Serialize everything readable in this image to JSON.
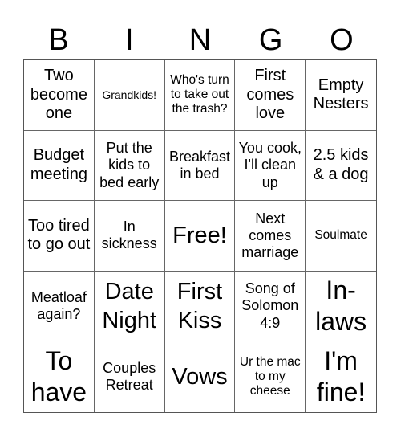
{
  "header": {
    "letters": [
      "B",
      "I",
      "N",
      "G",
      "O"
    ]
  },
  "cells": [
    {
      "text": "Two become one",
      "size": "s-lg"
    },
    {
      "text": "Grandkids!",
      "size": "s-xs"
    },
    {
      "text": "Who's turn to take out the trash?",
      "size": "s-sm"
    },
    {
      "text": "First comes love",
      "size": "s-lg"
    },
    {
      "text": "Empty Nesters",
      "size": "s-lg"
    },
    {
      "text": "Budget meeting",
      "size": "s-lg"
    },
    {
      "text": "Put the kids to bed early",
      "size": "s-md"
    },
    {
      "text": "Breakfast in bed",
      "size": "s-md"
    },
    {
      "text": "You cook, I'll clean up",
      "size": "s-md"
    },
    {
      "text": "2.5 kids & a dog",
      "size": "s-lg"
    },
    {
      "text": "Too tired to go out",
      "size": "s-lg"
    },
    {
      "text": "In sickness",
      "size": "s-md"
    },
    {
      "text": "Free!",
      "size": "s-xl"
    },
    {
      "text": "Next comes marriage",
      "size": "s-md"
    },
    {
      "text": "Soulmate",
      "size": "s-sm"
    },
    {
      "text": "Meatloaf again?",
      "size": "s-md"
    },
    {
      "text": "Date Night",
      "size": "s-xl"
    },
    {
      "text": "First Kiss",
      "size": "s-xl"
    },
    {
      "text": "Song of Solomon 4:9",
      "size": "s-md"
    },
    {
      "text": "In-laws",
      "size": "s-xxl"
    },
    {
      "text": "To have",
      "size": "s-xxl"
    },
    {
      "text": "Couples Retreat",
      "size": "s-md"
    },
    {
      "text": "Vows",
      "size": "s-xl"
    },
    {
      "text": "Ur the mac to my cheese",
      "size": "s-sm"
    },
    {
      "text": "I'm fine!",
      "size": "s-xxl"
    }
  ]
}
